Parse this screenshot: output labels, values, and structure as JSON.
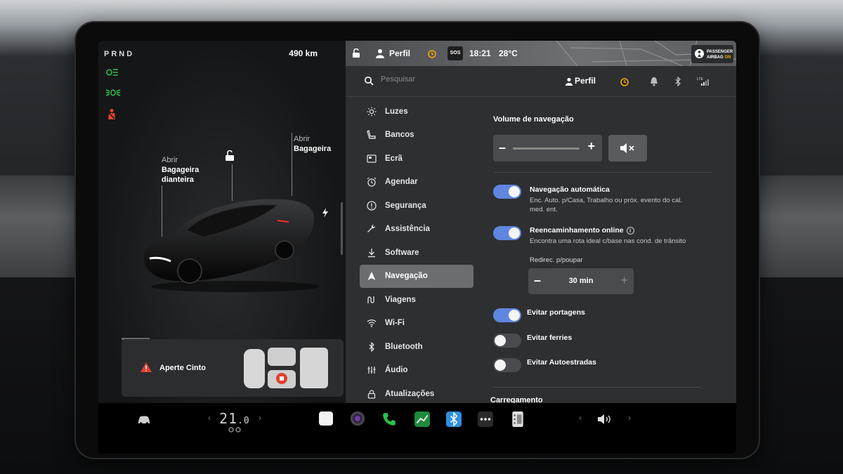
{
  "status": {
    "gear": "PRND",
    "range": "490 km",
    "profile": "Perfil",
    "sos": "SOS",
    "time": "18:21",
    "temperature": "28°C",
    "airbag_line1": "PASSENGER",
    "airbag_line2": "AIRBAG",
    "airbag_state": "ON"
  },
  "car": {
    "front_trunk": {
      "line1": "Abrir",
      "line2": "Bagageira",
      "line3": "dianteira"
    },
    "rear_trunk": {
      "line1": "Abrir",
      "line2": "Bagageira"
    },
    "alert": "Aperte Cinto"
  },
  "settings": {
    "search_placeholder": "Pesquisar",
    "profile_label": "Perfil",
    "menu": [
      {
        "label": "Luzes",
        "icon": "sun-icon"
      },
      {
        "label": "Bancos",
        "icon": "seat-icon"
      },
      {
        "label": "Ecrã",
        "icon": "display-icon"
      },
      {
        "label": "Agendar",
        "icon": "alarm-clock-icon"
      },
      {
        "label": "Segurança",
        "icon": "alert-circle-icon"
      },
      {
        "label": "Assistência",
        "icon": "wrench-icon"
      },
      {
        "label": "Software",
        "icon": "download-icon"
      },
      {
        "label": "Navegação",
        "icon": "navigation-arrow-icon",
        "active": true
      },
      {
        "label": "Viagens",
        "icon": "trips-icon"
      },
      {
        "label": "Wi-Fi",
        "icon": "wifi-icon"
      },
      {
        "label": "Bluetooth",
        "icon": "bluetooth-icon"
      },
      {
        "label": "Áudio",
        "icon": "equalizer-icon"
      },
      {
        "label": "Atualizações",
        "icon": "lock-icon"
      }
    ],
    "nav": {
      "volume_title": "Volume de navegação",
      "auto_nav_title": "Navegação automática",
      "auto_nav_desc1": "Enc. Auto. p/Casa, Trabalho ou próx. evento do cal.",
      "auto_nav_desc2": "med. ent.",
      "auto_nav_on": true,
      "online_title": "Reencaminhamento online",
      "online_desc": "Encontra uma rota ideal c/base nas cond. de trânsito",
      "online_on": true,
      "redirect_label": "Redirec. p/poupar",
      "redirect_value": "30 min",
      "avoid_tolls": "Evitar portagens",
      "avoid_tolls_on": true,
      "avoid_ferries": "Evitar ferries",
      "avoid_ferries_on": false,
      "avoid_highways": "Evitar Autoestradas",
      "avoid_highways_on": false,
      "charging_title": "Carregamento"
    }
  },
  "dock": {
    "temperature_whole": "21",
    "temperature_decimal": ".0"
  },
  "colors": {
    "accent_toggle": "#5f86e0",
    "alert_red": "#e2402f",
    "telltale_green": "#31c24e",
    "alarm_orange": "#f0a500"
  }
}
